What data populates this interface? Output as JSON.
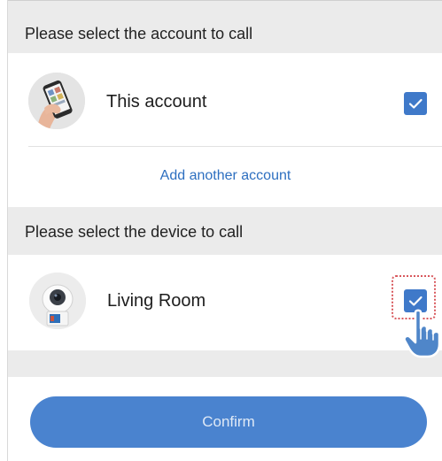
{
  "account_section": {
    "header": "Please select the account to call",
    "accounts": [
      {
        "label": "This account",
        "checked": true,
        "avatar_icon": "phone-in-hand-icon"
      }
    ],
    "add_link": "Add another account"
  },
  "device_section": {
    "header": "Please select the device to call",
    "devices": [
      {
        "label": "Living Room",
        "checked": true,
        "avatar_icon": "camera-device-icon"
      }
    ]
  },
  "confirm_button": {
    "label": "Confirm"
  },
  "colors": {
    "accent": "#3f79c9",
    "link": "#2d6fc0",
    "button": "#4a83cf",
    "section_bg": "#ebebeb",
    "highlight": "#d8585d"
  }
}
